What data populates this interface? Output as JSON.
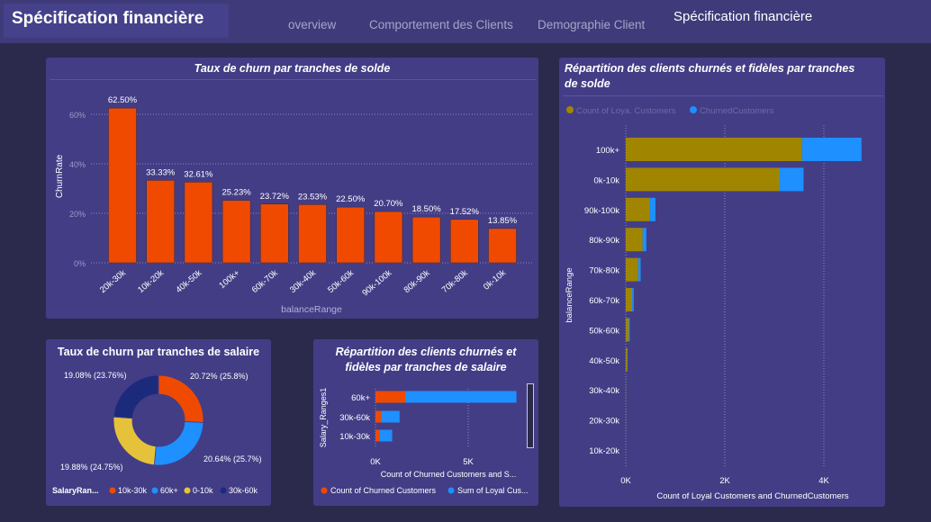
{
  "header": {
    "title": "Spécification financière",
    "tabs": [
      {
        "label": "overview"
      },
      {
        "label": "Comportement des Clients"
      },
      {
        "label": "Demographie Client"
      },
      {
        "label": "Spécification financière"
      }
    ]
  },
  "colors": {
    "background": "#2b2a4c",
    "card": "#433d86",
    "churn_orange": "#f04a00",
    "loyal_olive": "#a08600",
    "churned_blue": "#1e90ff",
    "donut_orange": "#f04a00",
    "donut_blue": "#1e90ff",
    "donut_yellow": "#e6c23a",
    "donut_navy": "#1c2a7c"
  },
  "cards": {
    "balance_churn": {
      "title": "Taux de churn par tranches de solde"
    },
    "balance_split": {
      "title": "Répartition des clients churnés et fidèles par tranches de solde"
    },
    "salary_churn": {
      "title": "Taux de churn par tranches de salaire"
    },
    "salary_split": {
      "title": "Répartition des clients churnés et fidèles par tranches de salaire"
    }
  },
  "chart_data": [
    {
      "id": "balance_churn",
      "type": "bar",
      "title": "Taux de churn par tranches de solde",
      "xlabel": "balanceRange",
      "ylabel": "ChurnRate",
      "ylim": [
        0,
        60
      ],
      "yticks": [
        "0%",
        "20%",
        "40%",
        "60%"
      ],
      "categories": [
        "20k-30k",
        "10k-20k",
        "40k-50k",
        "100k+",
        "60k-70k",
        "30k-40k",
        "50k-60k",
        "90k-100k",
        "80k-90k",
        "70k-80k",
        "0k-10k"
      ],
      "values": [
        62.5,
        33.33,
        32.61,
        25.23,
        23.72,
        23.53,
        22.5,
        20.7,
        18.5,
        17.52,
        13.85
      ],
      "labels": [
        "62.50%",
        "33.33%",
        "32.61%",
        "25.23%",
        "23.72%",
        "23.53%",
        "22.50%",
        "20.70%",
        "18.50%",
        "17.52%",
        "13.85%"
      ],
      "grid": true
    },
    {
      "id": "balance_split",
      "type": "bar",
      "orientation": "horizontal",
      "stacked": true,
      "title": "Répartition des clients churnés et fidèles par tranches de solde",
      "xlabel": "Count of Loyal Customers and ChurnedCustomers",
      "ylabel": "balanceRange",
      "xlim": [
        0,
        4800
      ],
      "xticks": [
        "0K",
        "2K",
        "4K"
      ],
      "legend_position": "top-left",
      "categories": [
        "100k+",
        "0k-10k",
        "90k-100k",
        "80k-90k",
        "70k-80k",
        "60k-70k",
        "50k-60k",
        "40k-50k",
        "30k-40k",
        "20k-30k",
        "10k-20k"
      ],
      "series": [
        {
          "name": "Count of Loya. Customers",
          "values": [
            3560,
            3100,
            480,
            340,
            250,
            130,
            62,
            30,
            3,
            3,
            1
          ]
        },
        {
          "name": "ChurnedCustomers",
          "values": [
            1200,
            490,
            120,
            75,
            50,
            30,
            18,
            8,
            1,
            1,
            0
          ]
        }
      ],
      "grid": true
    },
    {
      "id": "salary_churn",
      "type": "pie",
      "donut": true,
      "title": "Taux de churn par tranches de salaire",
      "legend_title": "SalaryRan...",
      "legend_position": "bottom",
      "slices": [
        {
          "name": "10k-30k",
          "value": 25.8,
          "label": "20.72% (25.8%)"
        },
        {
          "name": "60k+",
          "value": 25.7,
          "label": "20.64% (25.7%)"
        },
        {
          "name": "0-10k",
          "value": 24.75,
          "label": "19.88% (24.75%)"
        },
        {
          "name": "30k-60k",
          "value": 23.76,
          "label": "19.08% (23.76%)"
        }
      ]
    },
    {
      "id": "salary_split",
      "type": "bar",
      "orientation": "horizontal",
      "stacked": true,
      "title": "Répartition des clients churnés et fidèles par tranches de salaire",
      "xlabel": "Count of Churned Customers and S...",
      "ylabel": "Salary_Ranges1",
      "xlim": [
        0,
        8000
      ],
      "xticks": [
        "0K",
        "5K"
      ],
      "legend_position": "bottom",
      "categories": [
        "60k+",
        "30k-60k",
        "10k-30k"
      ],
      "series": [
        {
          "name": "Count of Churned Customers",
          "values": [
            1600,
            300,
            200
          ]
        },
        {
          "name": "Sum of Loyal Cus...",
          "values": [
            6000,
            1000,
            700
          ]
        }
      ],
      "grid": true
    }
  ]
}
